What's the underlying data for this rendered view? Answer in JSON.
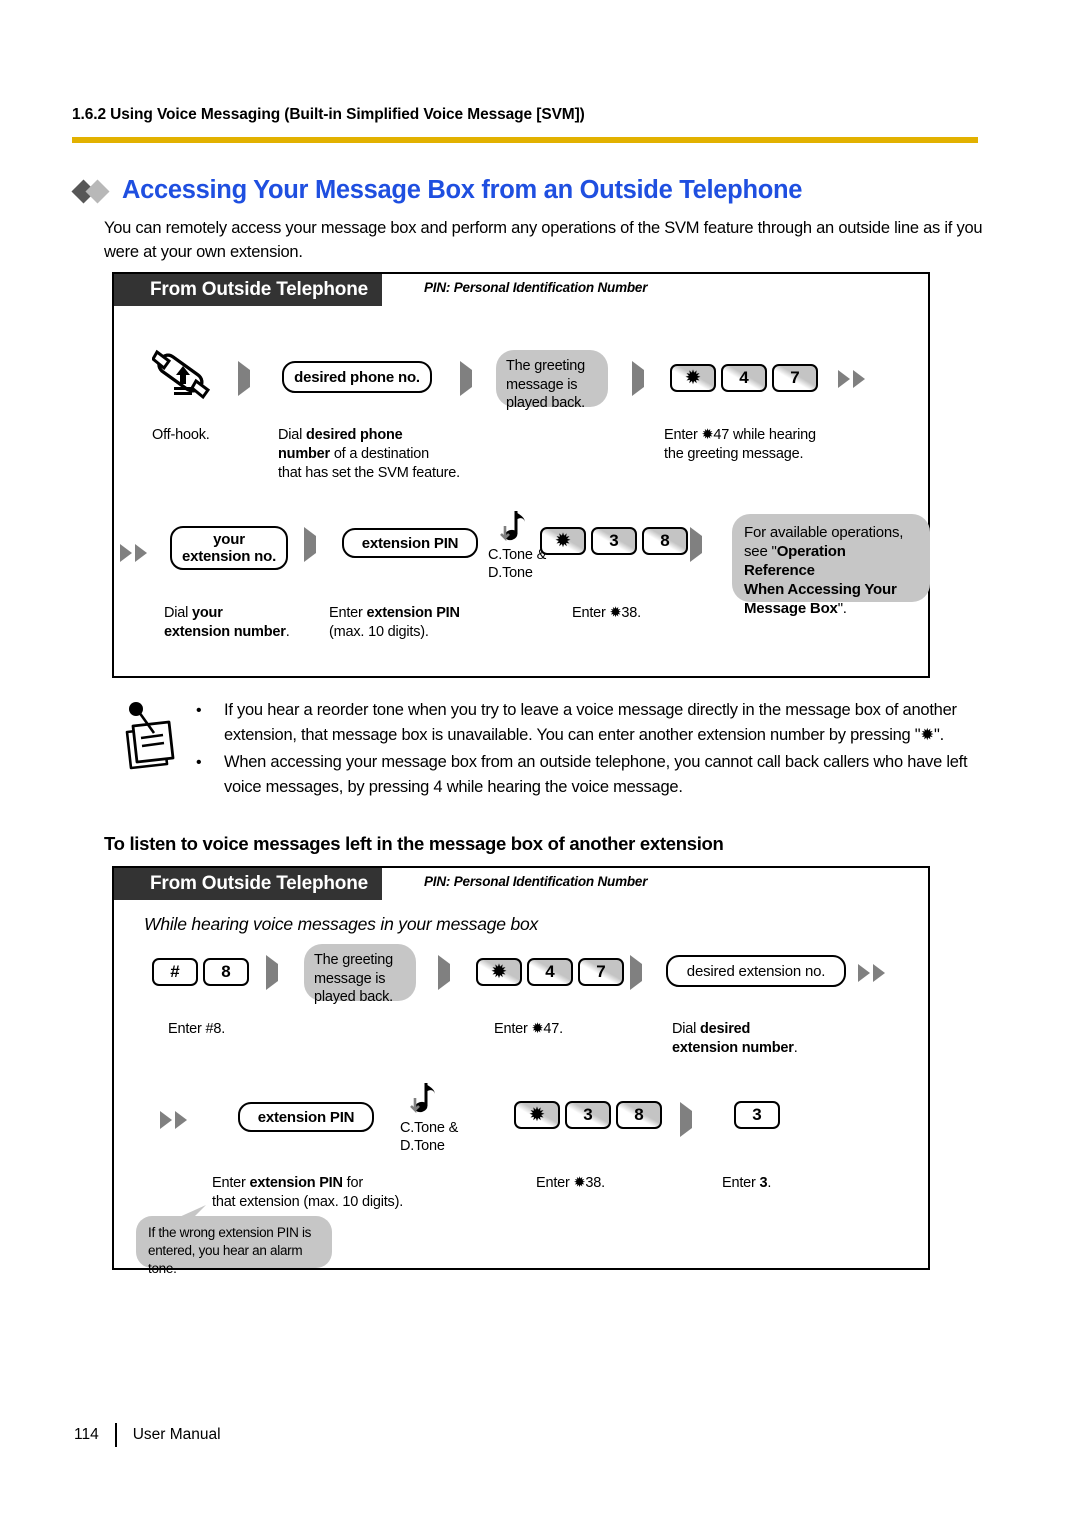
{
  "header": {
    "breadcrumb": "1.6.2 Using Voice Messaging (Built-in Simplified Voice Message [SVM])",
    "rule_color": "#e2b100"
  },
  "title": {
    "text": "Accessing Your Message Box from an Outside Telephone",
    "color": "#1f4fe0"
  },
  "intro": "You can remotely access your message box and perform any operations of the SVM feature through an outside line as if you were at your own extension.",
  "diagram1": {
    "header_label": "From Outside Telephone",
    "pin_note": "PIN: Personal Identification Number",
    "row1": {
      "icon_caption": "Off-hook.",
      "capsule1": "desired phone no.",
      "balloon1_line1": "The greeting",
      "balloon1_line2": "message is",
      "balloon1_line3": "played back.",
      "keys": [
        "✹",
        "4",
        "7"
      ],
      "caption2_l1_a": "Dial ",
      "caption2_l1_b": "desired phone",
      "caption2_l2_b": "number",
      "caption2_l2_a": " of a destination",
      "caption2_l3": "that has set the SVM feature.",
      "caption4_l1": "Enter ✹47 while hearing",
      "caption4_l2": "the greeting message."
    },
    "row2": {
      "capsule1_l1": "your",
      "capsule1_l2": "extension no.",
      "capsule2": "extension PIN",
      "tone_l1": "C.Tone &",
      "tone_l2": "D.Tone",
      "keys": [
        "✹",
        "3",
        "8"
      ],
      "balloon_l1": "For available operations,",
      "balloon_l2_a": "see \"",
      "balloon_l2_b": "Operation Reference",
      "balloon_l3_b": "When Accessing Your",
      "balloon_l4_b": "Message Box",
      "balloon_l4_a": "\".",
      "caption1_l1_a": "Dial ",
      "caption1_l1_b": "your",
      "caption1_l2_b": "extension number",
      "caption1_l2_a": ".",
      "caption2_l1_a": "Enter ",
      "caption2_l1_b": "extension PIN",
      "caption2_l2": "(max. 10 digits).",
      "caption3": "Enter ✹38."
    }
  },
  "notes": [
    "If you hear a reorder tone when you try to leave a voice message directly in the message box of another extension, that message box is unavailable. You can enter another extension number by pressing \"✹\".",
    "When accessing your message box from an outside telephone, you cannot call back callers who have left voice messages, by pressing 4 while hearing the voice message."
  ],
  "notes_bullet": "•",
  "section_heading": "To listen to voice messages left in the message box of another extension",
  "diagram2": {
    "header_label": "From Outside Telephone",
    "pin_note": "PIN: Personal Identification Number",
    "subtitle": "While hearing voice messages in your message box",
    "row1": {
      "keys_a": [
        "#",
        "8"
      ],
      "balloon_l1": "The greeting",
      "balloon_l2": "message is",
      "balloon_l3": "played back.",
      "keys_b": [
        "✹",
        "4",
        "7"
      ],
      "capsule": "desired extension no.",
      "caption1": "Enter #8.",
      "caption2": "Enter ✹47.",
      "caption3_l1_a": "Dial ",
      "caption3_l1_b": "desired",
      "caption3_l2_b": "extension number",
      "caption3_l2_a": "."
    },
    "row2": {
      "capsule": "extension PIN",
      "tone_l1": "C.Tone &",
      "tone_l2": "D.Tone",
      "keys": [
        "✹",
        "3",
        "8"
      ],
      "key_single": "3",
      "caption1_l1_a": "Enter ",
      "caption1_l1_b": "extension PIN",
      "caption1_l1_c": " for",
      "caption1_l2": "that extension (max. 10 digits).",
      "caption2": "Enter ✹38.",
      "caption3_a": "Enter ",
      "caption3_b": "3",
      "caption3_c": ".",
      "speech_l1": "If the wrong extension PIN is",
      "speech_l2": "entered, you hear an alarm tone."
    }
  },
  "footer": {
    "page_number": "114",
    "label": "User Manual"
  }
}
